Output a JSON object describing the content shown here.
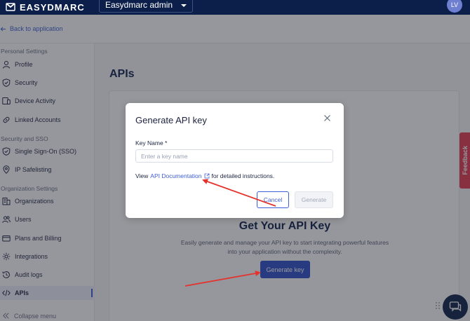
{
  "topbar": {
    "logo_text": "EASYDMARC",
    "org_name": "Easydmarc admin",
    "avatar_initials": "LV"
  },
  "back_link": "Back to application",
  "sidebar": {
    "sections": [
      {
        "title": "Personal Settings",
        "items": [
          {
            "label": "Profile",
            "icon": "user-icon"
          },
          {
            "label": "Security",
            "icon": "shield-check-icon"
          },
          {
            "label": "Device Activity",
            "icon": "devices-icon"
          },
          {
            "label": "Linked Accounts",
            "icon": "link-icon"
          }
        ]
      },
      {
        "title": "Security and SSO",
        "items": [
          {
            "label": "Single Sign-On (SSO)",
            "icon": "shield-check-icon"
          },
          {
            "label": "IP Safelisting",
            "icon": "location-pin-icon"
          }
        ]
      },
      {
        "title": "Organization Settings",
        "items": [
          {
            "label": "Organizations",
            "icon": "organization-icon"
          },
          {
            "label": "Users",
            "icon": "users-icon"
          },
          {
            "label": "Plans and Billing",
            "icon": "credit-card-icon"
          },
          {
            "label": "Integrations",
            "icon": "gear-icon"
          },
          {
            "label": "Audit logs",
            "icon": "clock-history-icon"
          },
          {
            "label": "APIs",
            "icon": "code-icon",
            "active": true
          }
        ]
      }
    ],
    "collapse_label": "Collapse menu"
  },
  "main": {
    "page_title": "APIs",
    "hero_title": "Get Your API Key",
    "hero_description": "Easily generate and manage your API key to start integrating powerful features into your application without the complexity.",
    "generate_key_label": "Generate key"
  },
  "feedback_label": "Feedback",
  "modal": {
    "title": "Generate API key",
    "field_label": "Key Name *",
    "input_value": "",
    "input_placeholder": "Enter a key name",
    "doc_prefix": "View",
    "doc_link": "API Documentation",
    "doc_suffix": "for detailed instructions.",
    "cancel_label": "Cancel",
    "generate_label": "Generate"
  },
  "colors": {
    "navy": "#0c1f4a",
    "primary": "#2e4fc9",
    "link": "#3d5ed6",
    "feedback": "#e53950",
    "annotation": "#e5322d"
  }
}
